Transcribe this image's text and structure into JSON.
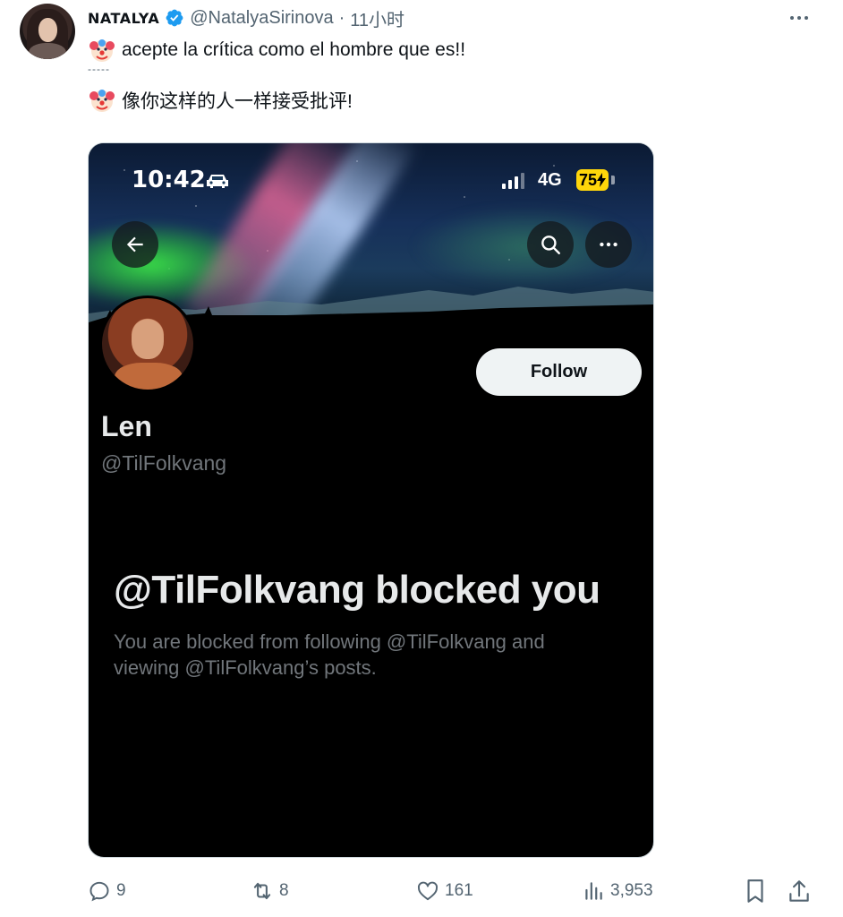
{
  "tweet": {
    "author_display_name": "NATALYA",
    "author_handle": "@NatalyaSirinova",
    "separator": "·",
    "time": "11小时",
    "line1": "acepte la crítica como el hombre que es!!",
    "divider": "-----",
    "line2": "像你这样的人一样接受批评!",
    "emoji_icon": "clown-face-emoji"
  },
  "screenshot": {
    "status_bar": {
      "time": "10:42",
      "network": "4G",
      "battery": "75"
    },
    "profile": {
      "name": "Len",
      "handle": "@TilFolkvang",
      "follow_label": "Follow"
    },
    "blocked": {
      "title": "@TilFolkvang blocked you",
      "description": "You are blocked from following @TilFolkvang and viewing @TilFolkvang’s posts."
    }
  },
  "actions": {
    "replies": "9",
    "retweets": "8",
    "likes": "161",
    "views": "3,953"
  },
  "colors": {
    "verified": "#1d9bf0",
    "muted": "#536471",
    "battery": "#ffd60a"
  }
}
